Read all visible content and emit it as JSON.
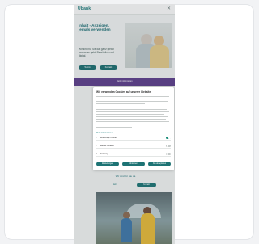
{
  "header": {
    "logo": "Ubank"
  },
  "hero": {
    "title": "Inhalt - Anzeigen, jemals verwenden",
    "subtitle": "Wir sind für Sie da, ganz gleich worum es geht. Persönlich und digital.",
    "button_primary": "Termin",
    "button_secondary": "Kontakt"
  },
  "band": {
    "text": "Jetzt informieren"
  },
  "cookie_modal": {
    "title": "Wir verwenden Cookies auf unserer Website",
    "link": "Mehr Informationen",
    "options": [
      {
        "label": "Notwendige Cookies",
        "enabled": true
      },
      {
        "label": "Statistik Cookies",
        "enabled": false
      },
      {
        "label": "Marketing",
        "enabled": false
      }
    ],
    "buttons": {
      "settings": "Einstellungen",
      "reject": "Ablehnen",
      "accept": "Alle akzeptieren"
    }
  },
  "section": {
    "title": "Wir sind für Sie da",
    "button_secondary": "Mehr",
    "button_primary": "Kontakt"
  },
  "colors": {
    "brand": "#1d7374",
    "band": "#5d3f8a",
    "toggle_on": "#1d8f7a"
  }
}
